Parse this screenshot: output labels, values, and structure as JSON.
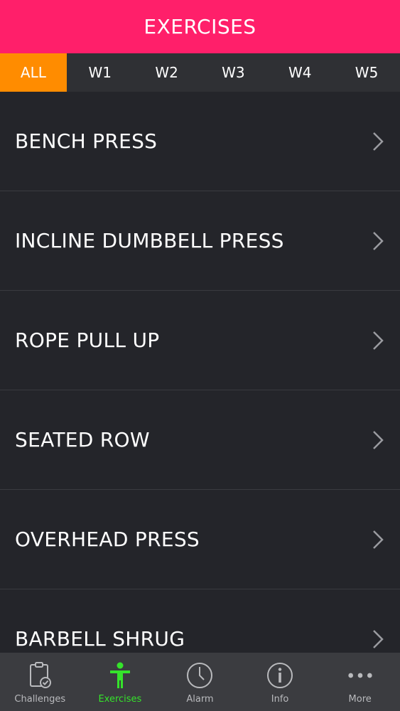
{
  "header": {
    "title": "EXERCISES"
  },
  "filter_tabs": [
    "ALL",
    "W1",
    "W2",
    "W3",
    "W4",
    "W5"
  ],
  "exercises": [
    "BENCH PRESS",
    "INCLINE DUMBBELL PRESS",
    "ROPE PULL UP",
    "SEATED ROW",
    "OVERHEAD PRESS",
    "BARBELL SHRUG"
  ],
  "bottom_tabs": [
    {
      "label": "Challenges",
      "icon": "clipboard-check-icon"
    },
    {
      "label": "Exercises",
      "icon": "person-icon"
    },
    {
      "label": "Alarm",
      "icon": "clock-icon"
    },
    {
      "label": "Info",
      "icon": "info-icon"
    },
    {
      "label": "More",
      "icon": "more-dots-icon"
    }
  ],
  "colors": {
    "header_bg": "#ff1f6a",
    "active_filter": "#ff8c00",
    "active_tab": "#35e32b",
    "background": "#24252a"
  }
}
